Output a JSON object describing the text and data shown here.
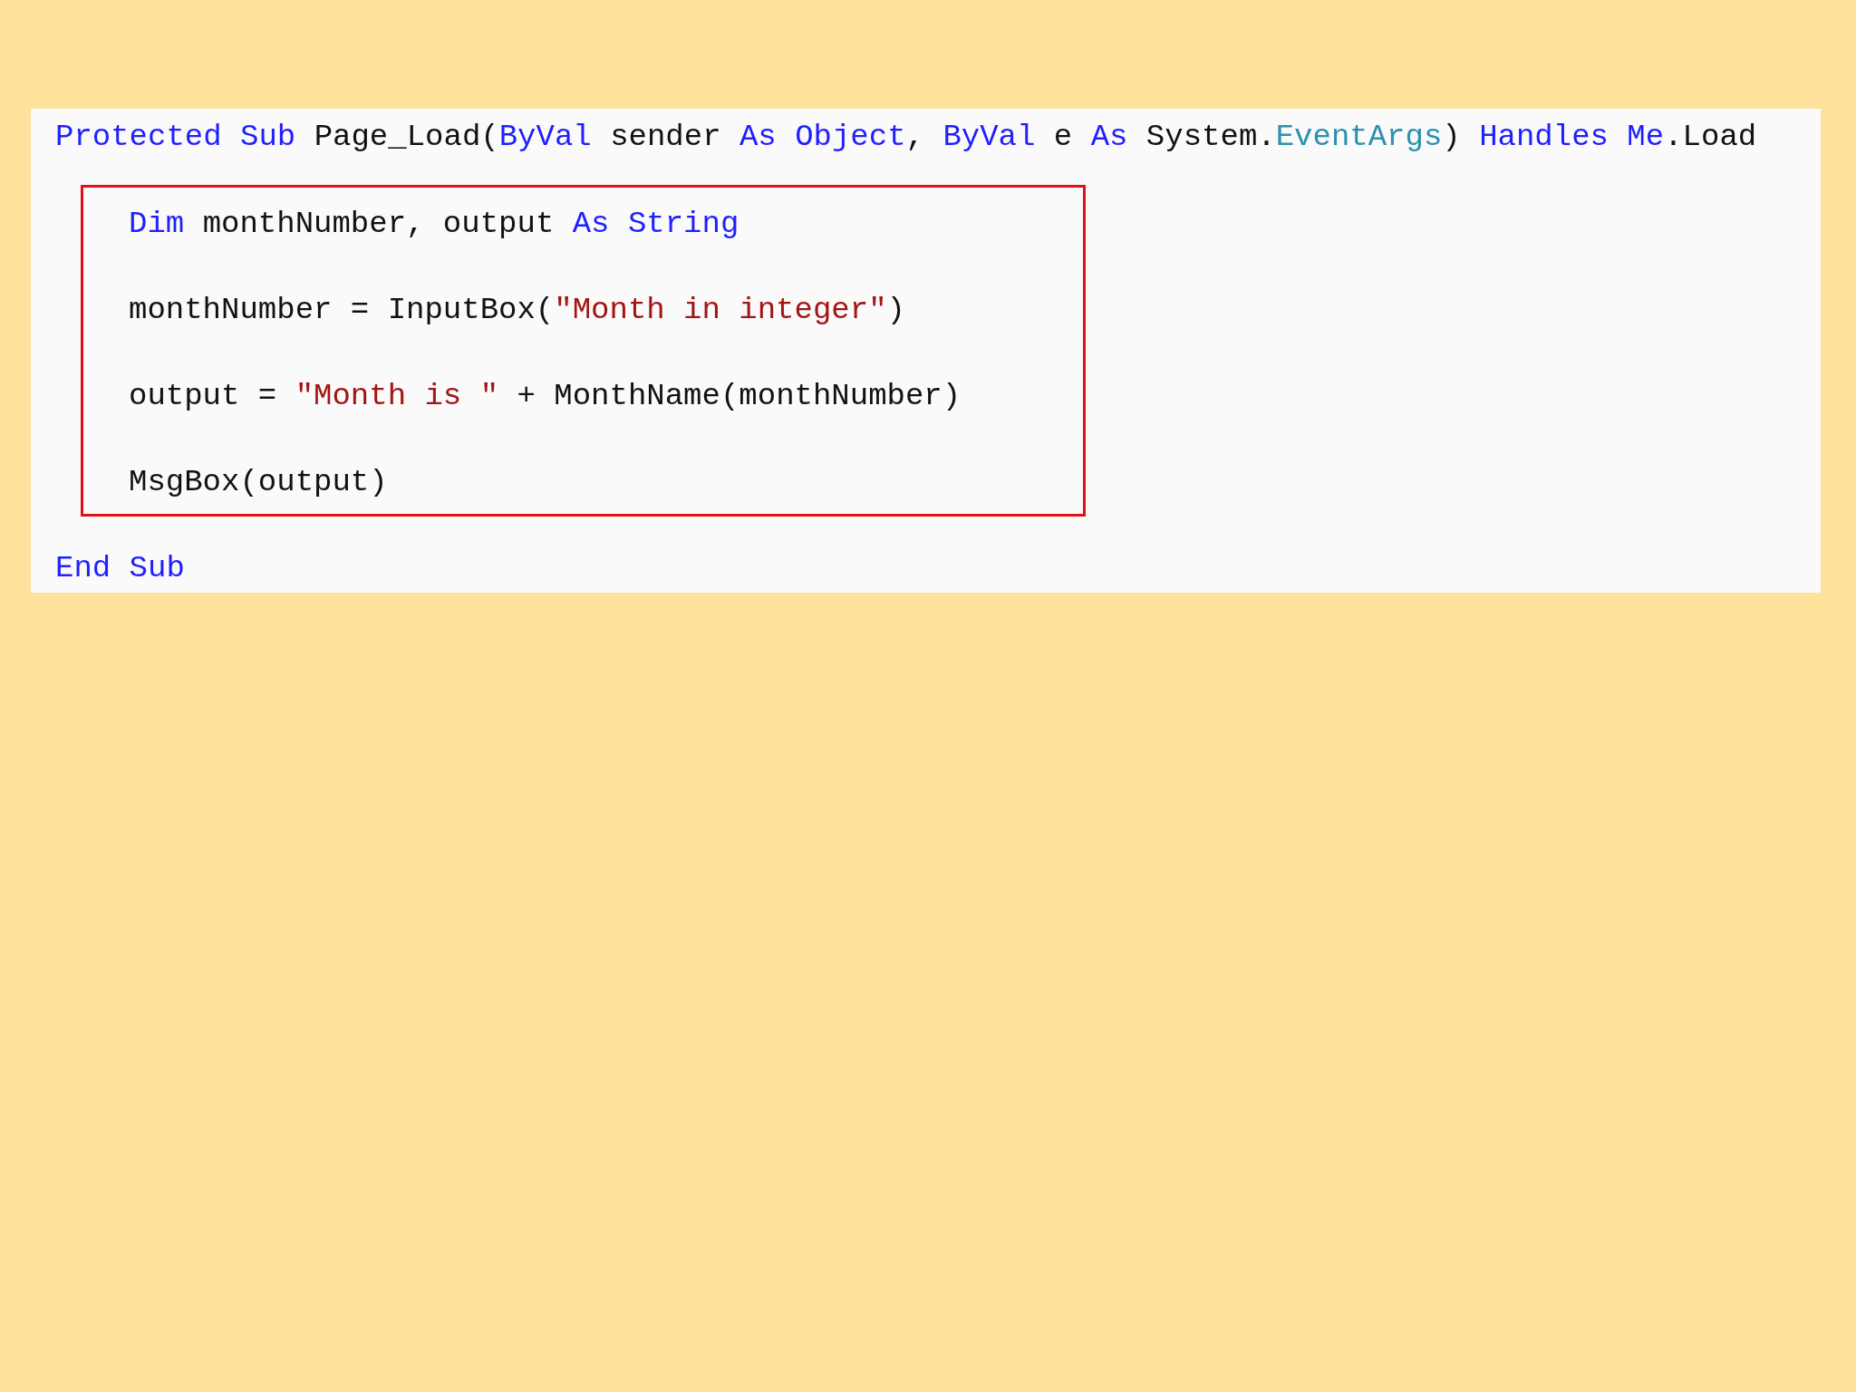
{
  "code": {
    "header": [
      {
        "kind": "keyword",
        "text": "Protected Sub "
      },
      {
        "kind": "plain",
        "text": "Page_Load("
      },
      {
        "kind": "keyword",
        "text": "ByVal "
      },
      {
        "kind": "plain",
        "text": "sender "
      },
      {
        "kind": "keyword",
        "text": "As Object"
      },
      {
        "kind": "plain",
        "text": ", "
      },
      {
        "kind": "keyword",
        "text": "ByVal "
      },
      {
        "kind": "plain",
        "text": "e "
      },
      {
        "kind": "keyword",
        "text": "As "
      },
      {
        "kind": "plain",
        "text": "System."
      },
      {
        "kind": "type",
        "text": "EventArgs"
      },
      {
        "kind": "plain",
        "text": ") "
      },
      {
        "kind": "keyword",
        "text": "Handles Me"
      },
      {
        "kind": "plain",
        "text": ".Load"
      }
    ],
    "highlighted_lines": [
      [
        {
          "kind": "keyword",
          "text": "Dim "
        },
        {
          "kind": "plain",
          "text": "monthNumber, output "
        },
        {
          "kind": "keyword",
          "text": "As String"
        }
      ],
      [
        {
          "kind": "plain",
          "text": "monthNumber = InputBox("
        },
        {
          "kind": "string",
          "text": "\"Month in integer\""
        },
        {
          "kind": "plain",
          "text": ")"
        }
      ],
      [
        {
          "kind": "plain",
          "text": "output = "
        },
        {
          "kind": "string",
          "text": "\"Month is \""
        },
        {
          "kind": "plain",
          "text": " + MonthName(monthNumber)"
        }
      ],
      [
        {
          "kind": "plain",
          "text": "MsgBox(output)"
        }
      ]
    ],
    "footer": [
      {
        "kind": "keyword",
        "text": "End Sub"
      }
    ]
  }
}
